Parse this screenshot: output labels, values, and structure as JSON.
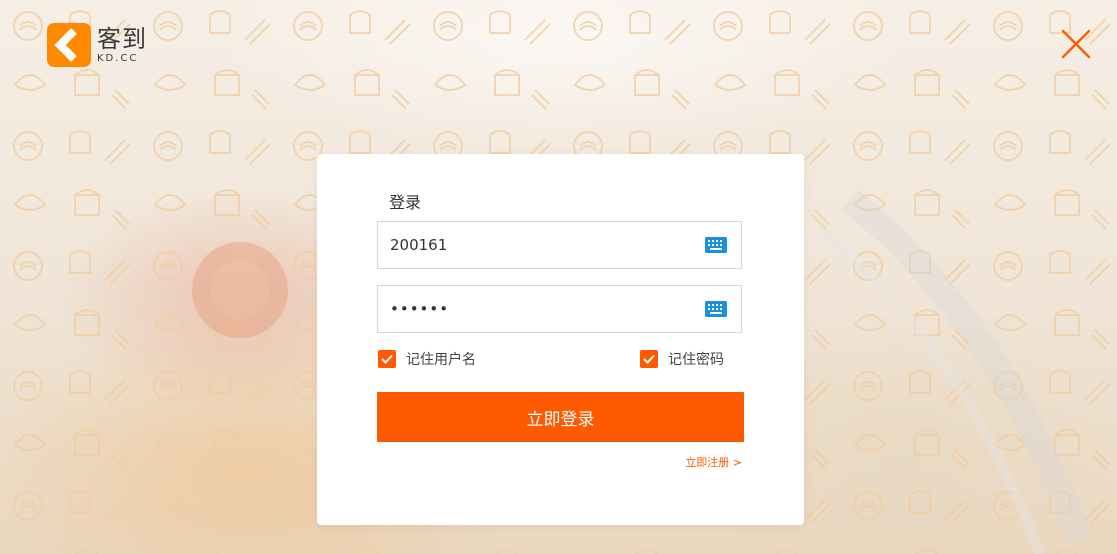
{
  "brand": {
    "name_cn": "客到",
    "name_en": "KD.CC"
  },
  "colors": {
    "accent": "#ff5a00",
    "logo_orange": "#ff8a00",
    "text": "#333333",
    "border": "#d6d6d6"
  },
  "icons": {
    "close": "close-icon",
    "keyboard": "keyboard-icon",
    "check": "check-icon"
  },
  "login": {
    "title": "登录",
    "username_value": "200161",
    "password_value": "••••••",
    "remember_username": {
      "label": "记住用户名",
      "checked": true
    },
    "remember_password": {
      "label": "记住密码",
      "checked": true
    },
    "submit_label": "立即登录",
    "register_label": "立即注册 >"
  }
}
